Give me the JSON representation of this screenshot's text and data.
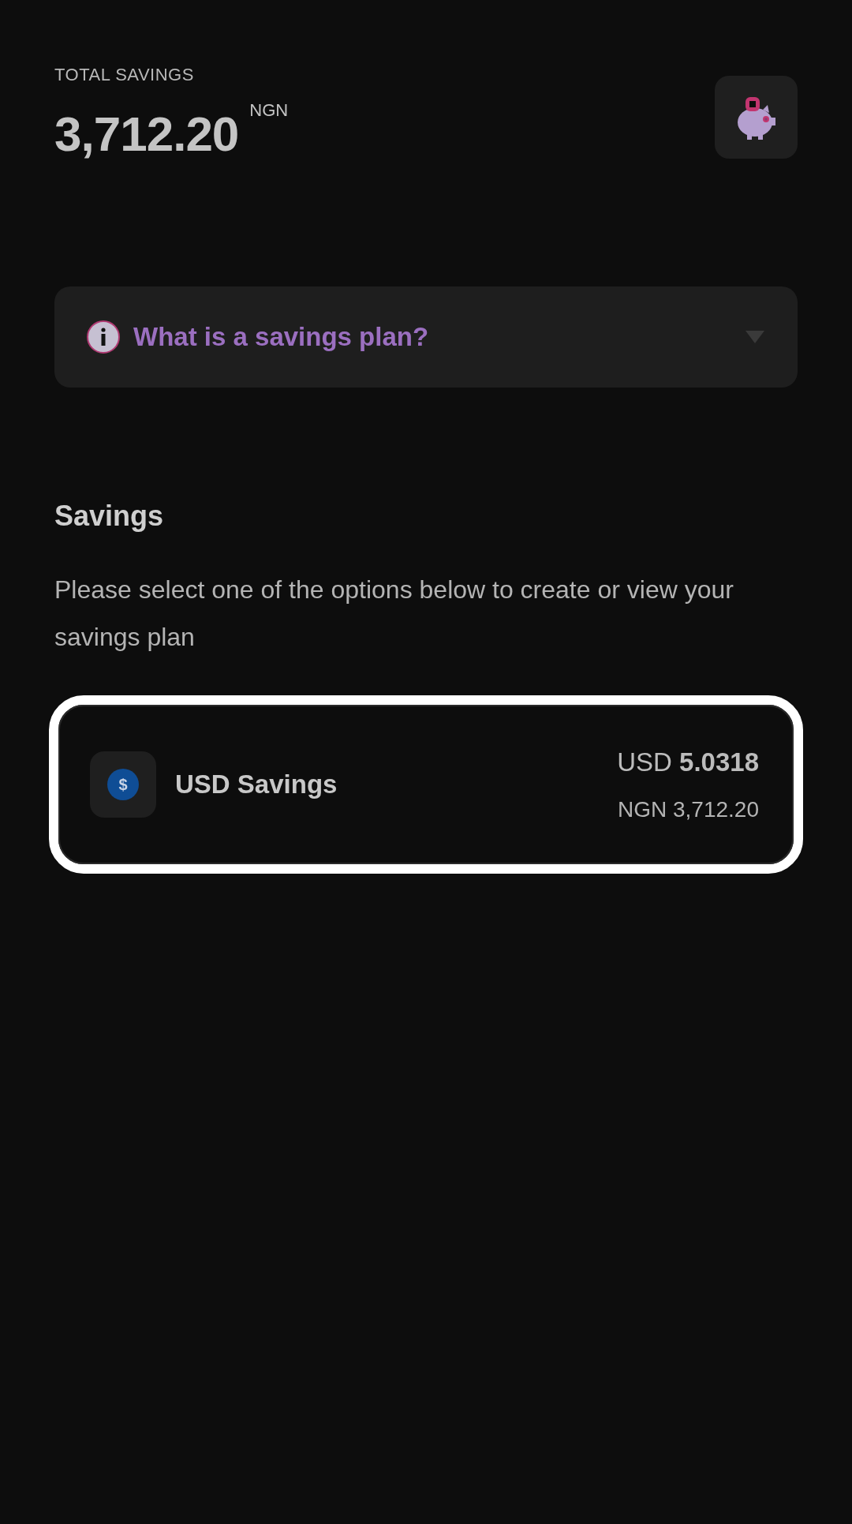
{
  "header": {
    "label": "TOTAL SAVINGS",
    "amount": "3,712.20",
    "currency": "NGN"
  },
  "info": {
    "question": "What is a savings plan?",
    "expanded": false
  },
  "section": {
    "title": "Savings",
    "description": "Please select one of the options below to create or view your savings plan"
  },
  "plans": [
    {
      "symbol": "$",
      "name": "USD Savings",
      "primary": "USD **5.0318**",
      "secondary": "NGN 3,712.20",
      "selected": true
    }
  ]
}
